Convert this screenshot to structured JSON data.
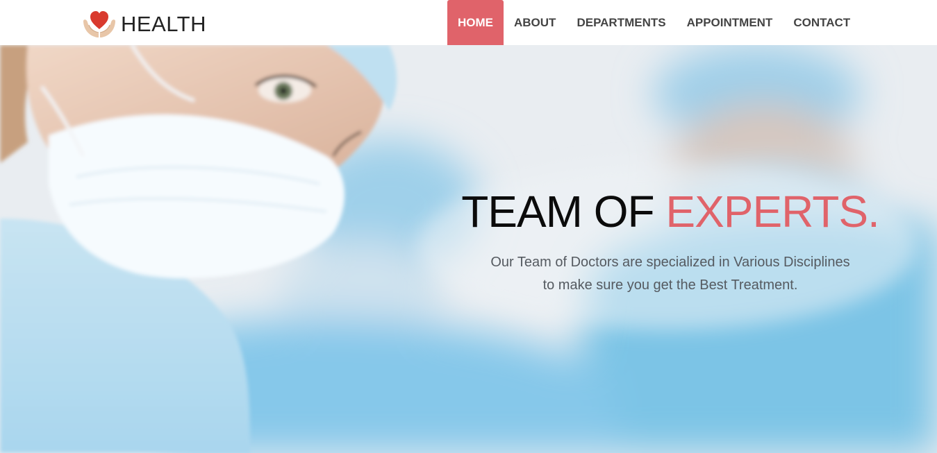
{
  "brand": {
    "name": "HEALTH",
    "logo_icon": "heart-in-hands-icon",
    "colors": {
      "heart": "#d93a2e",
      "hands": "#e8c6a8"
    }
  },
  "nav": {
    "items": [
      {
        "label": "HOME",
        "active": true
      },
      {
        "label": "ABOUT",
        "active": false
      },
      {
        "label": "DEPARTMENTS",
        "active": false
      },
      {
        "label": "APPOINTMENT",
        "active": false
      },
      {
        "label": "CONTACT",
        "active": false
      }
    ]
  },
  "hero": {
    "title_main": "TEAM OF",
    "title_accent": "EXPERTS.",
    "subtitle_line1": "Our Team of Doctors are specialized in Various Disciplines",
    "subtitle_line2": "to make sure you get the Best Treatment."
  },
  "colors": {
    "accent": "#e0636a",
    "nav_text": "#444444",
    "title_text": "#0b0b0b",
    "subtitle_text": "#555a60",
    "scrubs_blue": "#8fcbe8"
  }
}
